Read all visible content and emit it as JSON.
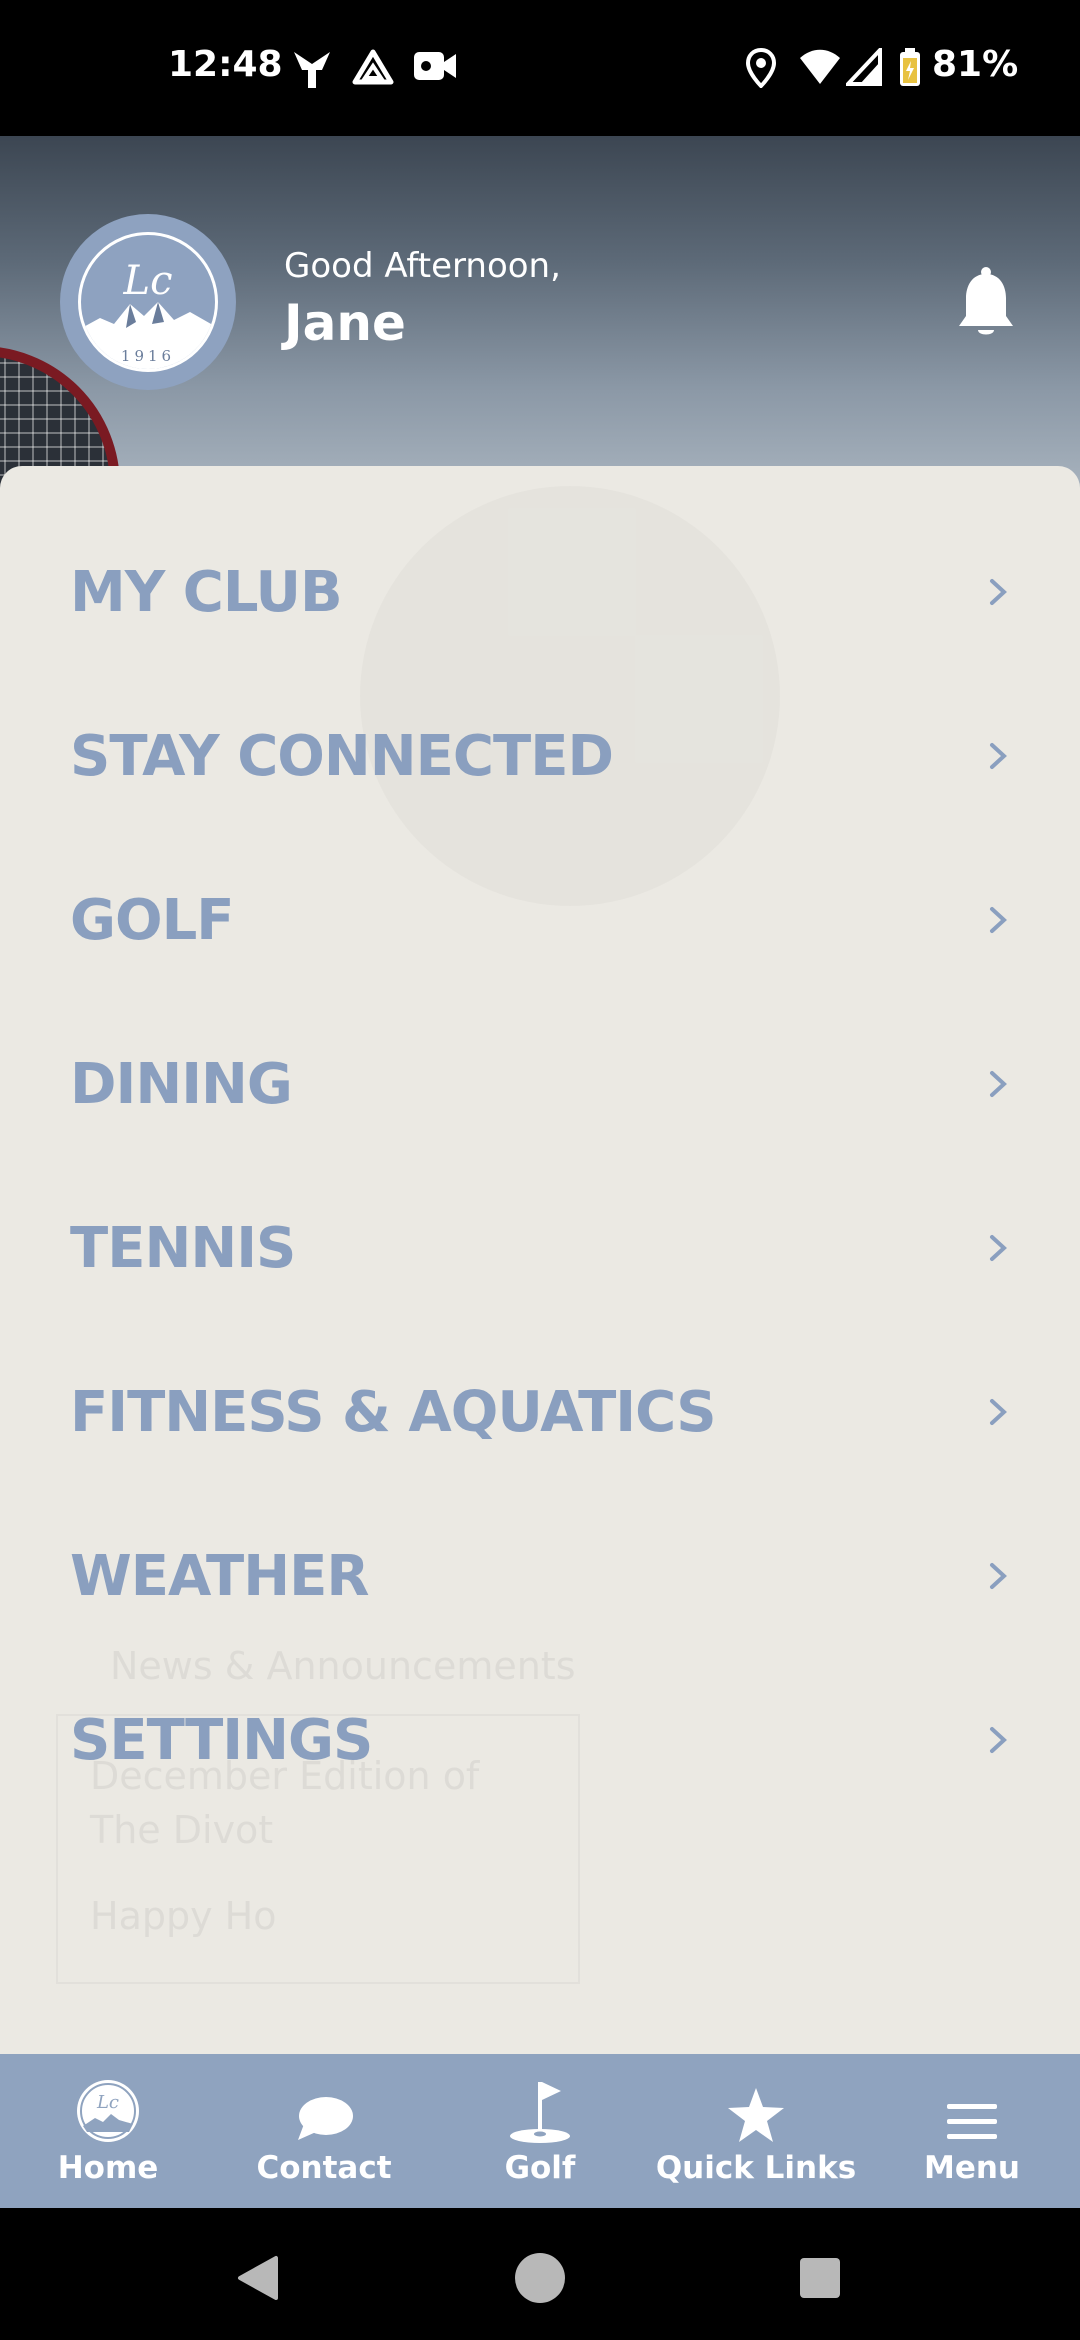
{
  "status_bar": {
    "time": "12:48",
    "battery": "81%",
    "icons": [
      "download-arrow-icon",
      "drive-icon",
      "video-camera-icon",
      "location-icon",
      "wifi-icon",
      "cell-signal-icon",
      "battery-icon"
    ]
  },
  "header": {
    "logo_year": "1916",
    "greeting": "Good Afternoon,",
    "user_name": "Jane"
  },
  "menu": {
    "items": [
      {
        "label": "MY CLUB"
      },
      {
        "label": "STAY CONNECTED"
      },
      {
        "label": "GOLF"
      },
      {
        "label": "DINING"
      },
      {
        "label": "TENNIS"
      },
      {
        "label": "FITNESS & AQUATICS"
      },
      {
        "label": "WEATHER"
      },
      {
        "label": "SETTINGS"
      }
    ],
    "ghost": {
      "news_heading": "News & Announcements",
      "line1": "December Edition of",
      "line2": "The Divot",
      "line3": "Happy Ho"
    }
  },
  "tab_bar": {
    "tabs": [
      {
        "label": "Home",
        "icon": "club-logo-icon"
      },
      {
        "label": "Contact",
        "icon": "chat-bubble-icon"
      },
      {
        "label": "Golf",
        "icon": "golf-flag-icon"
      },
      {
        "label": "Quick Links",
        "icon": "star-icon"
      },
      {
        "label": "Menu",
        "icon": "hamburger-menu-icon"
      }
    ]
  },
  "colors": {
    "accent": "#8a9fbf",
    "tab_bar": "#8fa3bf",
    "panel": "#ebe9e3"
  }
}
